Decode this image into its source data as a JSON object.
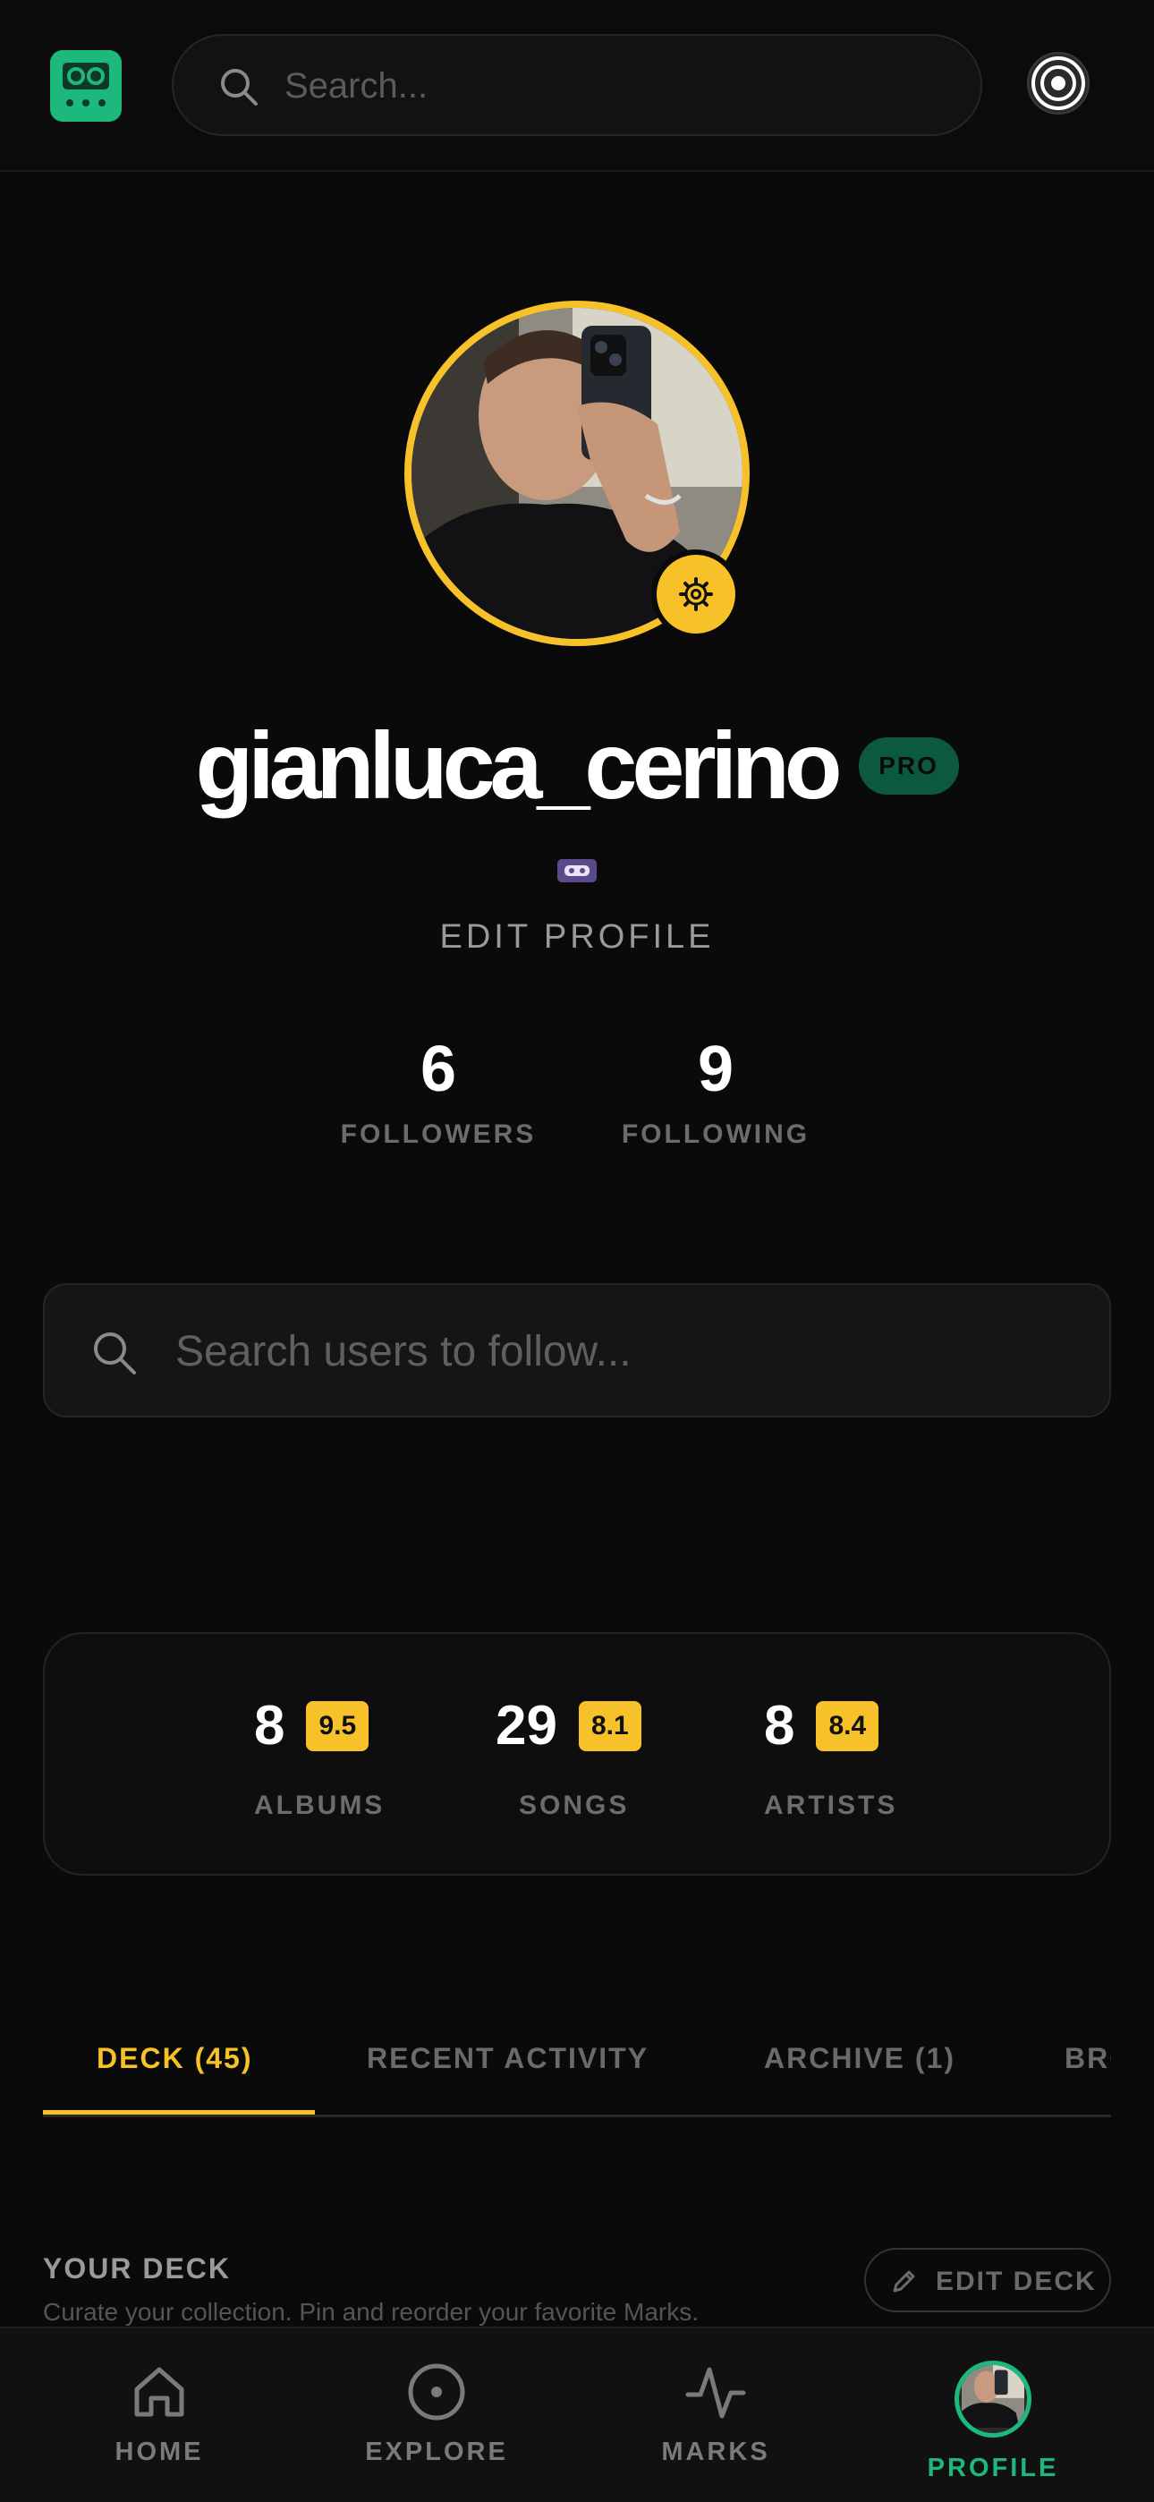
{
  "header": {
    "logo_icon": "cassette-logo-icon",
    "search_placeholder": "Search...",
    "radar_icon": "radar-icon"
  },
  "profile": {
    "username": "gianluca_cerino",
    "badge": "PRO",
    "status_emoji": "videocassette-emoji",
    "edit_label": "EDIT PROFILE",
    "followers_count": "6",
    "followers_label": "FOLLOWERS",
    "following_count": "9",
    "following_label": "FOLLOWING"
  },
  "user_search": {
    "placeholder": "Search users to follow..."
  },
  "ratings": [
    {
      "count": "8",
      "score": "9.5",
      "label": "ALBUMS"
    },
    {
      "count": "29",
      "score": "8.1",
      "label": "SONGS"
    },
    {
      "count": "8",
      "score": "8.4",
      "label": "ARTISTS"
    }
  ],
  "tabs": [
    {
      "label": "DECK (45)",
      "active": true
    },
    {
      "label": "RECENT ACTIVITY",
      "active": false
    },
    {
      "label": "ARCHIVE (1)",
      "active": false
    },
    {
      "label": "BROWSE",
      "active": false
    }
  ],
  "deck": {
    "title": "YOUR DECK",
    "subtitle": "Curate your collection. Pin and reorder your favorite Marks.",
    "edit_label": "EDIT DECK"
  },
  "bottom_nav": [
    {
      "label": "HOME",
      "icon": "home-icon"
    },
    {
      "label": "EXPLORE",
      "icon": "disc-icon"
    },
    {
      "label": "MARKS",
      "icon": "activity-icon"
    },
    {
      "label": "PROFILE",
      "icon": "avatar",
      "active": true
    }
  ],
  "colors": {
    "background": "#0a0a0a",
    "accent_yellow": "#f7c12a",
    "accent_green": "#1db87c",
    "pro_badge_bg": "#0c5a3e"
  }
}
